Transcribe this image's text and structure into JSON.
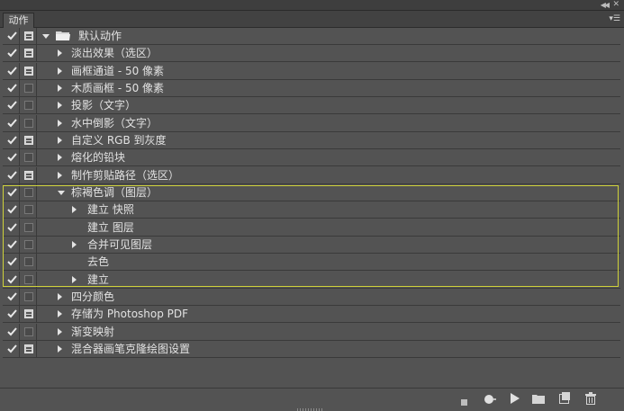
{
  "header": {
    "tab_label": "动作",
    "collapse_icon": "double-chevron-icon",
    "close_icon": "close-icon",
    "menu_icon": "panel-menu-icon"
  },
  "actions": [
    {
      "label": "默认动作",
      "level": 0,
      "type": "set",
      "expanded": true,
      "dialog": true
    },
    {
      "label": "淡出效果（选区）",
      "level": 1,
      "type": "action",
      "expanded": false,
      "dialog": true
    },
    {
      "label": "画框通道 - 50 像素",
      "level": 1,
      "type": "action",
      "expanded": false,
      "dialog": true
    },
    {
      "label": "木质画框 - 50 像素",
      "level": 1,
      "type": "action",
      "expanded": false,
      "dialog": false
    },
    {
      "label": "投影（文字）",
      "level": 1,
      "type": "action",
      "expanded": false,
      "dialog": false
    },
    {
      "label": "水中倒影（文字）",
      "level": 1,
      "type": "action",
      "expanded": false,
      "dialog": false
    },
    {
      "label": "自定义 RGB 到灰度",
      "level": 1,
      "type": "action",
      "expanded": false,
      "dialog": true
    },
    {
      "label": "熔化的铅块",
      "level": 1,
      "type": "action",
      "expanded": false,
      "dialog": false
    },
    {
      "label": "制作剪贴路径（选区）",
      "level": 1,
      "type": "action",
      "expanded": false,
      "dialog": true
    },
    {
      "label": "棕褐色调（图层）",
      "level": 1,
      "type": "action",
      "expanded": true,
      "dialog": false
    },
    {
      "label": "建立 快照",
      "level": 2,
      "type": "step",
      "expandable": true,
      "dialog": false
    },
    {
      "label": "建立 图层",
      "level": 2,
      "type": "step",
      "expandable": false,
      "dialog": false
    },
    {
      "label": "合并可见图层",
      "level": 2,
      "type": "step",
      "expandable": true,
      "dialog": false
    },
    {
      "label": "去色",
      "level": 2,
      "type": "step",
      "expandable": false,
      "dialog": false
    },
    {
      "label": "建立",
      "level": 2,
      "type": "step",
      "expandable": true,
      "dialog": false
    },
    {
      "label": "四分颜色",
      "level": 1,
      "type": "action",
      "expanded": false,
      "dialog": false
    },
    {
      "label": "存储为 Photoshop PDF",
      "level": 1,
      "type": "action",
      "expanded": false,
      "dialog": true
    },
    {
      "label": "渐变映射",
      "level": 1,
      "type": "action",
      "expanded": false,
      "dialog": false
    },
    {
      "label": "混合器画笔克隆绘图设置",
      "level": 1,
      "type": "action",
      "expanded": false,
      "dialog": true
    }
  ],
  "toolbar": [
    {
      "icon": "stop-icon"
    },
    {
      "icon": "record-icon"
    },
    {
      "icon": "play-icon"
    },
    {
      "icon": "new-set-folder-icon"
    },
    {
      "icon": "new-action-icon"
    },
    {
      "icon": "trash-icon"
    }
  ],
  "colors": {
    "panel_bg": "#535353",
    "highlight_border": "#cfd23a"
  }
}
